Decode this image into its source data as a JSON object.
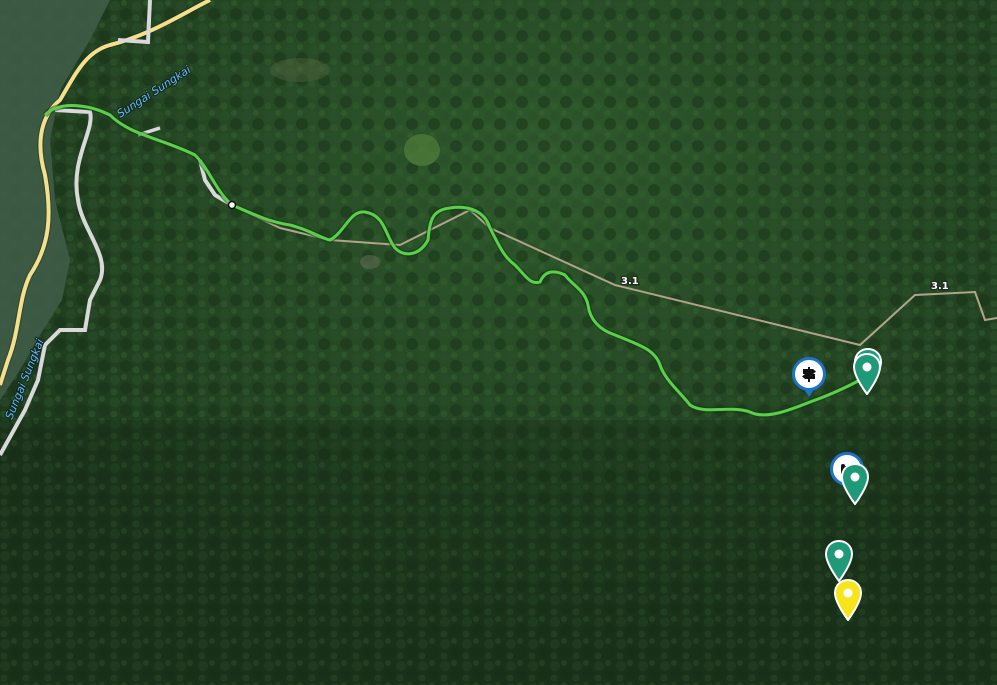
{
  "map": {
    "type": "satellite",
    "colors": {
      "forest_dark": "#1f3a1f",
      "forest_mid": "#2f5a2c",
      "water": "#3f5c47",
      "main_road": "#f2e08a",
      "minor_road": "#d9d9d9",
      "track": "#b2a48a",
      "route": "#5ad04a",
      "waypoint_teal": "#1f9a78",
      "waypoint_yellow": "#f5e51a",
      "signpost_blue": "#1e73c8"
    }
  },
  "labels": {
    "river_1": "Sungai Sungkai",
    "river_2": "Sungai Sungkai",
    "road_1": "3.1",
    "road_2": "3.1"
  },
  "markers": {
    "signpost_icon": "signpost-icon",
    "viewpoint_icon": "binoculars-icon",
    "waypoint_icon": "map-pin-icon"
  }
}
